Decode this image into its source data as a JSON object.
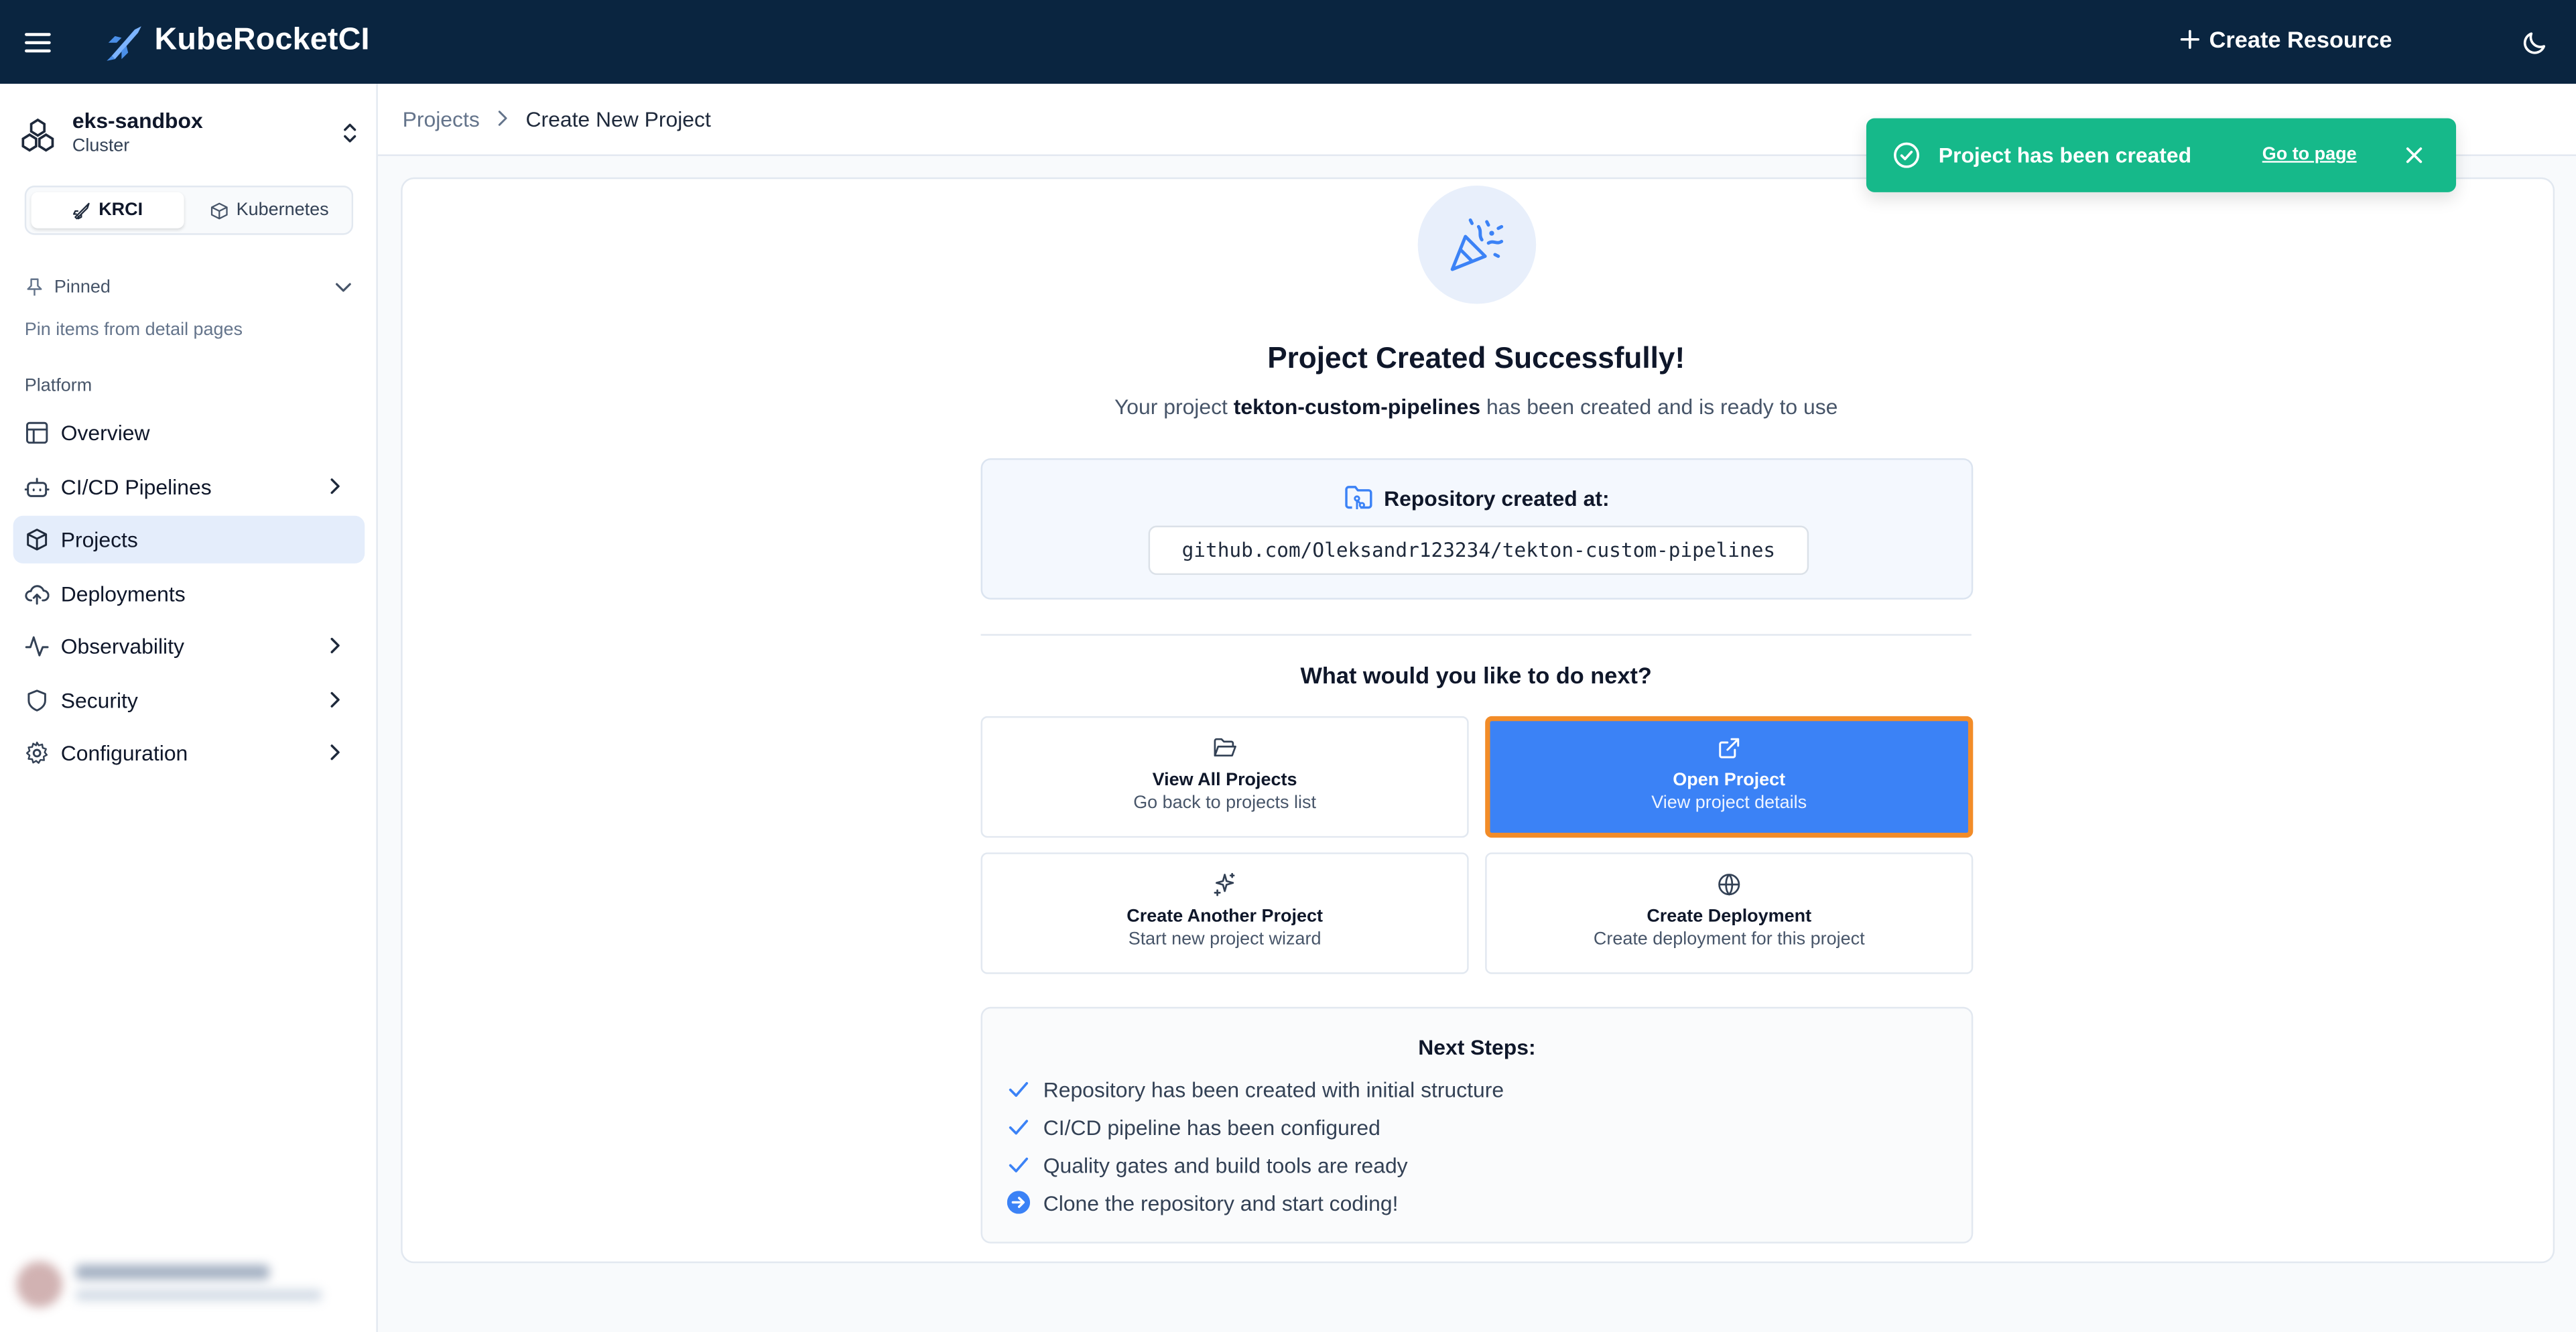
{
  "header": {
    "brand": "KubeRocketCI",
    "create_resource": "Create Resource"
  },
  "sidebar": {
    "cluster": {
      "name": "eks-sandbox",
      "type": "Cluster"
    },
    "mode": {
      "krci": "KRCI",
      "kubernetes": "Kubernetes"
    },
    "pinned": {
      "label": "Pinned",
      "hint": "Pin items from detail pages"
    },
    "section": "Platform",
    "items": [
      {
        "label": "Overview",
        "icon": "layout-icon"
      },
      {
        "label": "CI/CD Pipelines",
        "icon": "bot-icon"
      },
      {
        "label": "Projects",
        "icon": "box-icon",
        "active": true
      },
      {
        "label": "Deployments",
        "icon": "cloud-upload-icon"
      },
      {
        "label": "Observability",
        "icon": "activity-icon"
      },
      {
        "label": "Security",
        "icon": "shield-icon"
      },
      {
        "label": "Configuration",
        "icon": "gear-icon"
      }
    ]
  },
  "breadcrumb": {
    "parent": "Projects",
    "current": "Create New Project"
  },
  "toast": {
    "message": "Project has been created",
    "link": "Go to page",
    "color": "#16b98a"
  },
  "main": {
    "title": "Project Created Successfully!",
    "subtitle_prefix": "Your project ",
    "project_name": "tekton-custom-pipelines",
    "subtitle_suffix": " has been created and is ready to use",
    "repo_label": "Repository created at:",
    "repo_url": "github.com/Oleksandr123234/tekton-custom-pipelines",
    "next_question": "What would you like to do next?",
    "actions": [
      {
        "title": "View All Projects",
        "subtitle": "Go back to projects list",
        "icon": "folder-open-icon"
      },
      {
        "title": "Open Project",
        "subtitle": "View project details",
        "icon": "external-link-icon",
        "primary": true
      },
      {
        "title": "Create Another Project",
        "subtitle": "Start new project wizard",
        "icon": "sparkles-icon"
      },
      {
        "title": "Create Deployment",
        "subtitle": "Create deployment for this project",
        "icon": "globe-icon"
      }
    ],
    "next_steps": {
      "title": "Next Steps:",
      "items": [
        {
          "text": "Repository has been created with initial structure",
          "state": "done"
        },
        {
          "text": "CI/CD pipeline has been configured",
          "state": "done"
        },
        {
          "text": "Quality gates and build tools are ready",
          "state": "done"
        },
        {
          "text": "Clone the repository and start coding!",
          "state": "next"
        }
      ]
    }
  },
  "colors": {
    "topbar": "#0a2540",
    "primary": "#3b82f6",
    "highlight_border": "#f28c28",
    "active_nav": "#e4edfb"
  }
}
